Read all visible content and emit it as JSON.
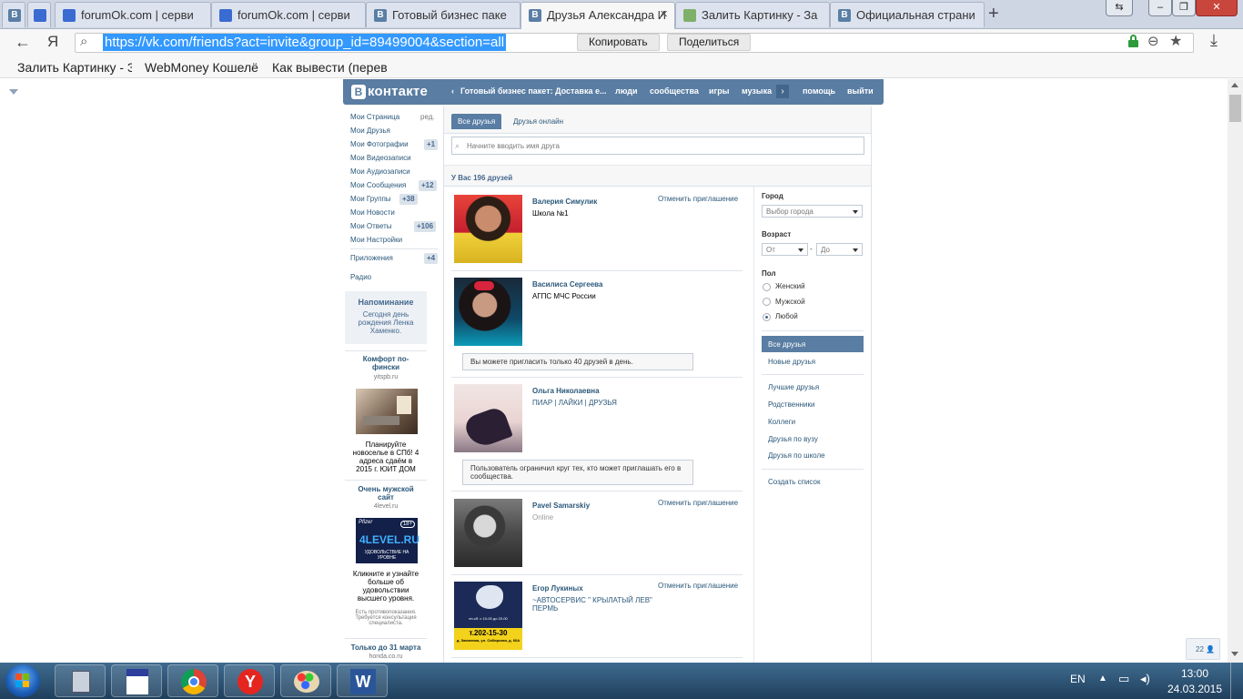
{
  "browser": {
    "tabs": [
      {
        "label": "forumOk.com | серви"
      },
      {
        "label": "forumOk.com | серви"
      },
      {
        "label": "Готовый бизнес паке"
      },
      {
        "label": "Друзья Александра И"
      },
      {
        "label": "Залить Картинку - За"
      },
      {
        "label": "Официальная страни"
      }
    ],
    "new_tab": "+",
    "close_tab": "×",
    "url": "https://vk.com/friends?act=invite&group_id=89499004&section=all",
    "copy_label": "Копировать",
    "share_label": "Поделиться",
    "yandex_label": "Я",
    "bookmarks": [
      "Залить Картинку - З",
      "WebMoney Кошелё",
      "Как вывести (переве"
    ]
  },
  "vk": {
    "logo_text": "контакте",
    "logo_letter": "В",
    "nav": {
      "group_link": "Готовый бизнес пакет: Доставка е...",
      "people": "люди",
      "communities": "сообщества",
      "games": "игры",
      "music": "музыка",
      "help": "помощь",
      "logout": "выйти"
    },
    "sidebar": {
      "items": [
        {
          "label": "Мои Страница",
          "extra": "ред."
        },
        {
          "label": "Мои Друзья",
          "extra": ""
        },
        {
          "label": "Мои Фотографии",
          "extra": "+1"
        },
        {
          "label": "Мои Видеозаписи",
          "extra": ""
        },
        {
          "label": "Мои Аудиозаписи",
          "extra": ""
        },
        {
          "label": "Мои Сообщения",
          "extra": "+12"
        },
        {
          "label": "Мои Группы",
          "extra": "+38"
        },
        {
          "label": "Мои Новости",
          "extra": ""
        },
        {
          "label": "Мои Ответы",
          "extra": "+106"
        },
        {
          "label": "Мои Настройки",
          "extra": ""
        }
      ],
      "apps": "Приложения",
      "apps_count": "+4",
      "radio": "Радио",
      "reminder_title": "Напоминание",
      "reminder_text": "Сегодня день рождения Ленка Хаменко.",
      "ads": [
        {
          "title": "Комфорт по-фински",
          "domain": "yitspb.ru",
          "text": "Планируйте новоселье в СПб! 4 адреса сдаём в 2015 г. ЮИТ ДОМ"
        },
        {
          "title": "Очень мужской сайт",
          "domain": "4level.ru",
          "text": "Кликните и узнайте больше об удовольствии высшего уровня.",
          "disclaimer": "Есть противопоказания. Требуется консультация специалиста.",
          "image_text": "4LEVEL.RU",
          "image_sub": "УДОВОЛЬСТВИЕ НА УРОВНЕ",
          "brand": "Pfizer",
          "age": "18+"
        },
        {
          "title": "Только до 31 марта",
          "domain": "honda.co.ru"
        }
      ]
    },
    "tabs": {
      "all": "Все друзья",
      "online": "Друзья онлайн"
    },
    "search_placeholder": "Начните вводить имя друга",
    "summary": "У Вас 196 друзей",
    "friends": [
      {
        "name": "Валерия Симулик",
        "sub": "Школа №1",
        "action": "Отменить приглашение"
      },
      {
        "name": "Василиса Сергеева",
        "sub": "АГПС МЧС России",
        "action": "",
        "note": "Вы можете пригласить только 40 друзей в день."
      },
      {
        "name": "Ольга Николаевна",
        "sub": "ПИАР | ЛАЙКИ | ДРУЗЬЯ",
        "action": "",
        "note": "Пользователь ограничил круг тех, кто может приглашать его в сообщества."
      },
      {
        "name": "Pavel Samarskiy",
        "sub": "Online",
        "action": "Отменить приглашение"
      },
      {
        "name": "Егор Лукиных",
        "sub": "~АВТОСЕРВИС \" КРЫЛАТЫЙ ЛЕВ\" ПЕРМЬ",
        "action": "Отменить приглашение",
        "photo_text": "т.202-15-30",
        "photo_hours": "пн-сб: с 10-00 до 20-00",
        "photo_addr": "д. Заюлянка, ул. Сибирская, д. 60А"
      }
    ],
    "filters": {
      "city_label": "Город",
      "city_select": "Выбор города",
      "age_label": "Возраст",
      "age_from": "От",
      "age_dash": "-",
      "age_to": "До",
      "sex_label": "Пол",
      "female": "Женский",
      "male": "Мужской",
      "any": "Любой",
      "lists": [
        "Все друзья",
        "Новые друзья",
        "Лучшие друзья",
        "Родственники",
        "Коллеги",
        "Друзья по вузу",
        "Друзья по школе",
        "Создать список"
      ]
    },
    "chat_counter": "22"
  },
  "taskbar": {
    "lang": "EN",
    "time": "13:00",
    "date": "24.03.2015"
  }
}
